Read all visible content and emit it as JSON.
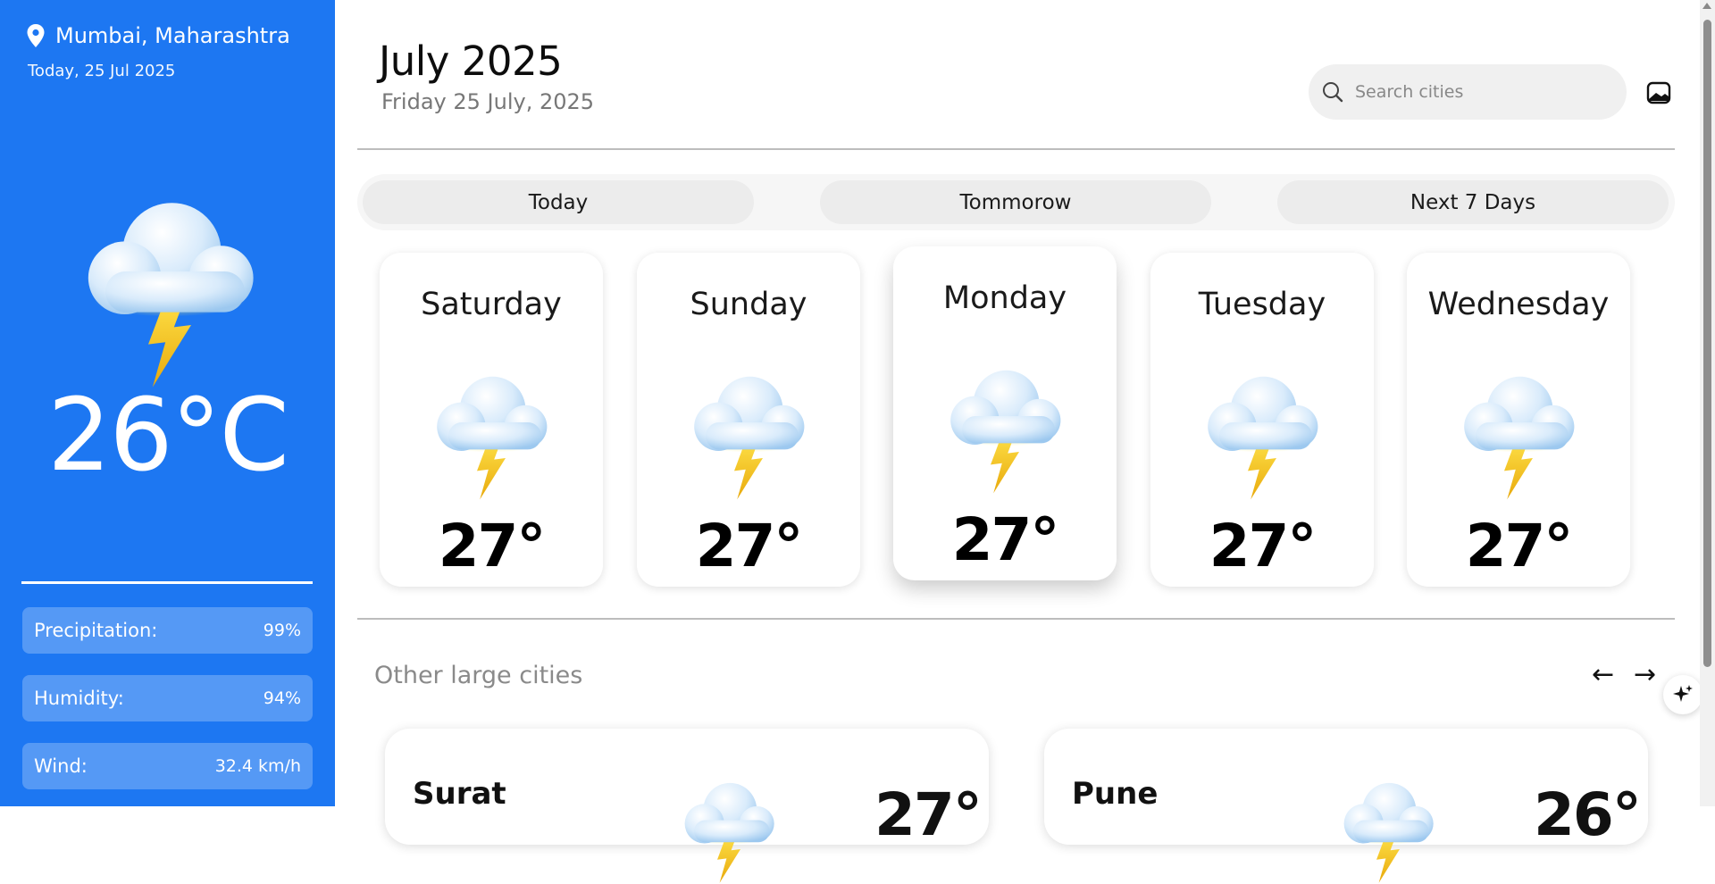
{
  "sidebar": {
    "location": "Mumbai, Maharashtra",
    "date": "Today, 25 Jul 2025",
    "icon": "thunderstorm-cloud-icon",
    "temperature": "26°C",
    "stats": [
      {
        "label": "Precipitation:",
        "value": "99%"
      },
      {
        "label": "Humidity:",
        "value": "94%"
      },
      {
        "label": "Wind:",
        "value": "32.4 km/h"
      }
    ]
  },
  "header": {
    "month": "July 2025",
    "full_date": "Friday 25 July, 2025",
    "search_placeholder": "Search cities",
    "search_icon": "search-icon",
    "theme_icon": "image-toggle-icon"
  },
  "tabs": [
    {
      "label": "Today"
    },
    {
      "label": "Tommorow"
    },
    {
      "label": "Next 7 Days"
    }
  ],
  "forecast": [
    {
      "day": "Saturday",
      "temp": "27°",
      "icon": "thunderstorm-cloud-icon"
    },
    {
      "day": "Sunday",
      "temp": "27°",
      "icon": "thunderstorm-cloud-icon"
    },
    {
      "day": "Monday",
      "temp": "27°",
      "icon": "thunderstorm-cloud-icon",
      "active": true
    },
    {
      "day": "Tuesday",
      "temp": "27°",
      "icon": "thunderstorm-cloud-icon"
    },
    {
      "day": "Wednesday",
      "temp": "27°",
      "icon": "thunderstorm-cloud-icon"
    }
  ],
  "other_cities": {
    "title": "Other large cities",
    "prev": "←",
    "next": "→",
    "cities": [
      {
        "name": "Surat",
        "temp": "27°"
      },
      {
        "name": "Pune",
        "temp": "26°"
      }
    ]
  },
  "colors": {
    "sidebar_bg": "#1d77f2",
    "stat_bg": "rgba(255,255,255,0.25)",
    "bolt": "#f3c51c"
  }
}
